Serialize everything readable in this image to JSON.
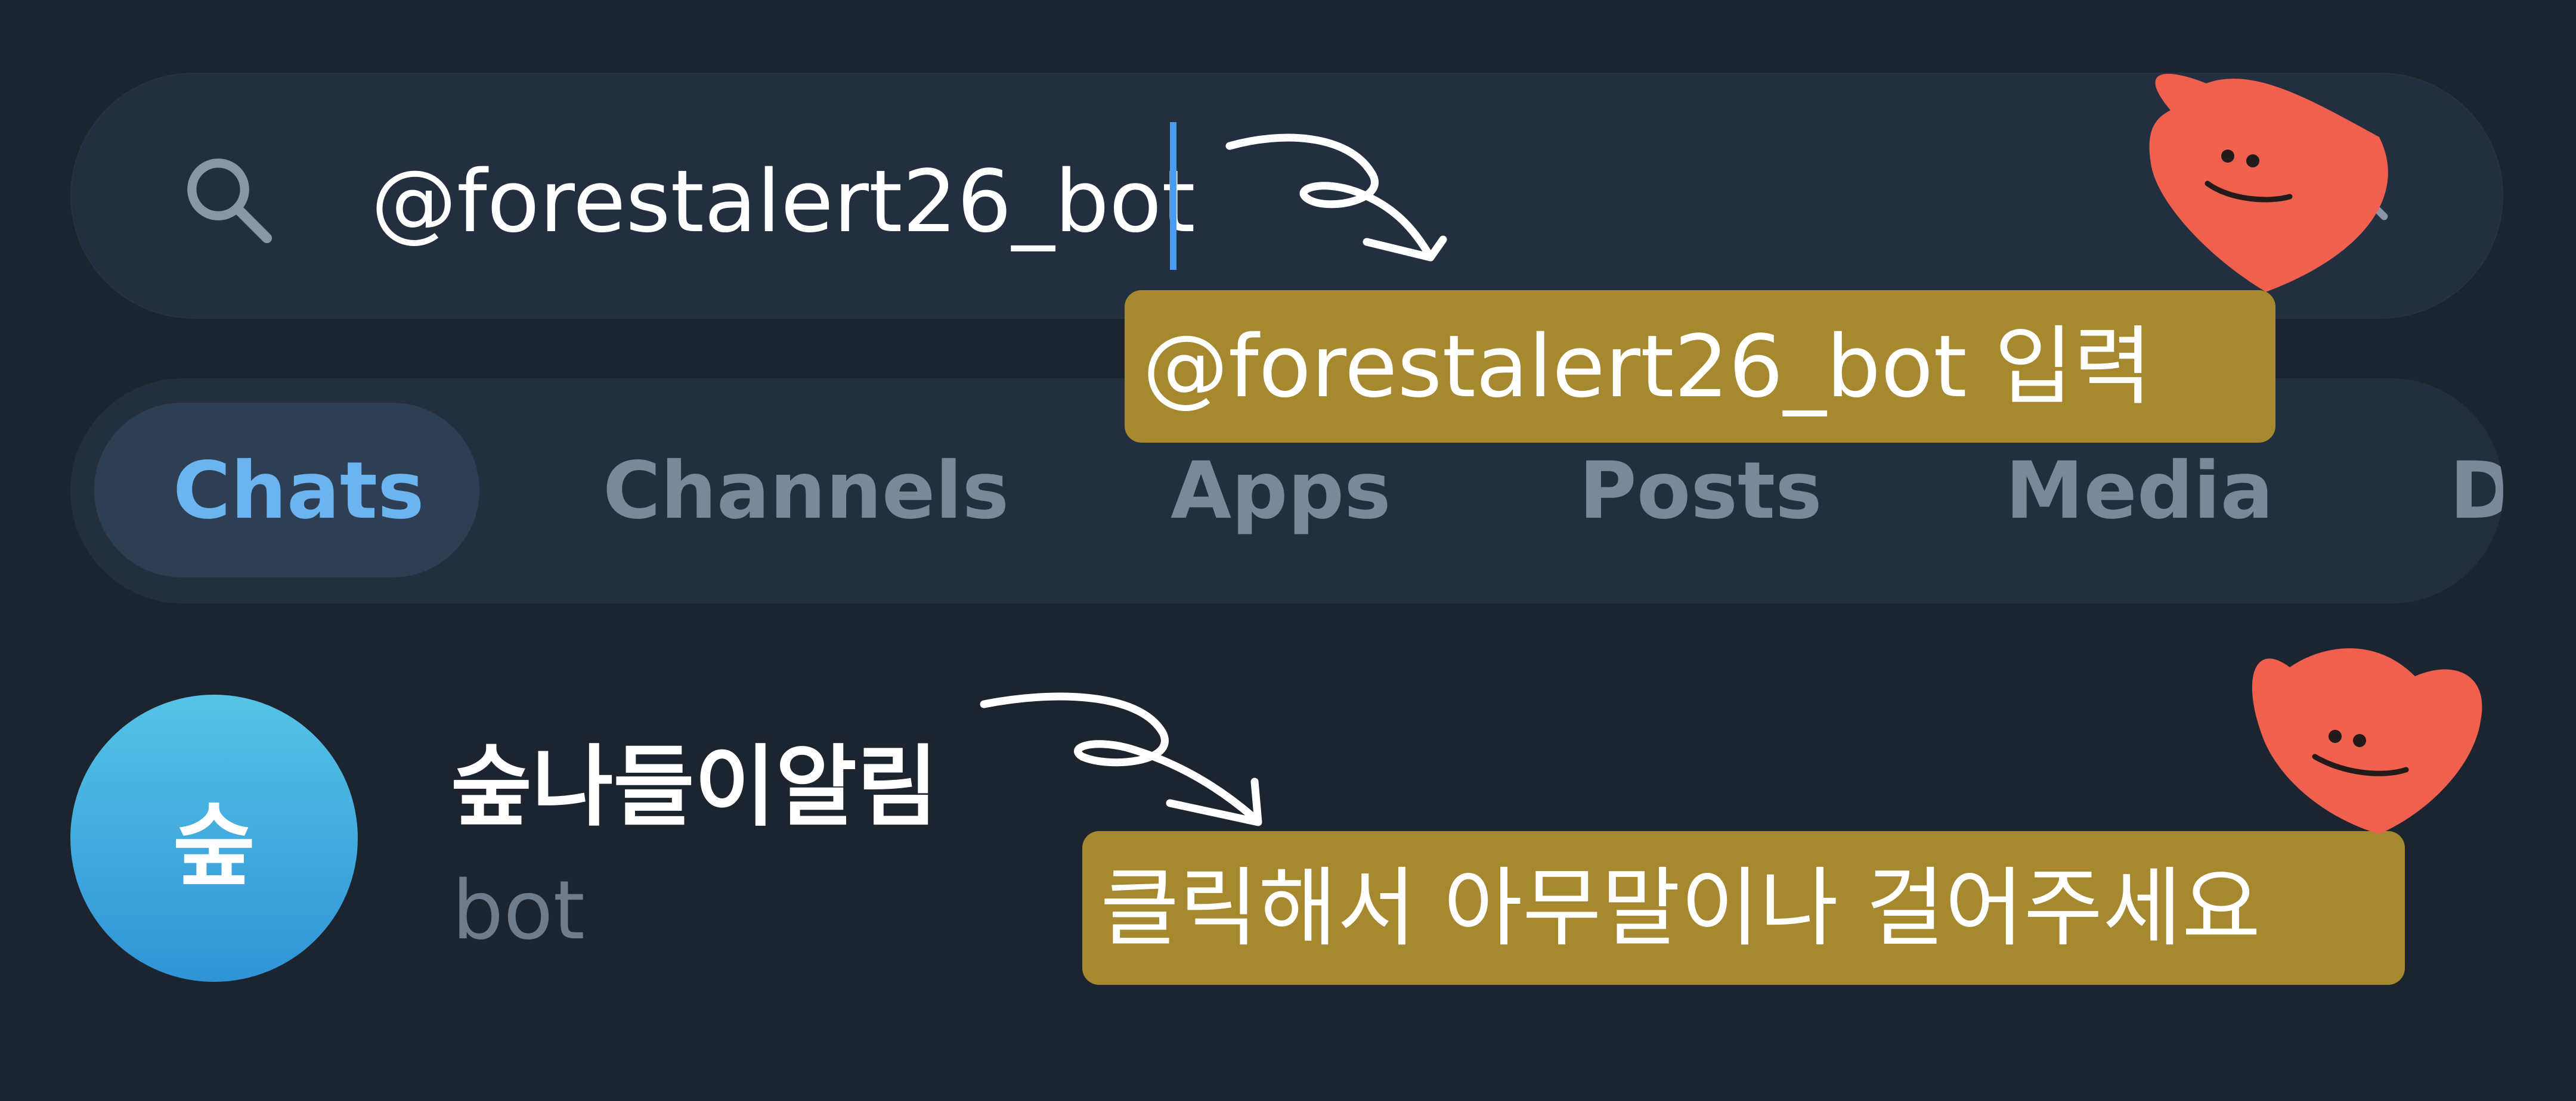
{
  "search": {
    "value": "@forestalert26_bot",
    "search_icon": "search-icon",
    "clear_icon": "close-icon"
  },
  "tabs": [
    {
      "label": "Chats",
      "active": true
    },
    {
      "label": "Channels",
      "active": false
    },
    {
      "label": "Apps",
      "active": false
    },
    {
      "label": "Posts",
      "active": false
    },
    {
      "label": "Media",
      "active": false
    },
    {
      "label": "D",
      "active": false
    }
  ],
  "result": {
    "avatar_text": "숲",
    "title": "숲나들이알림",
    "subtitle": "bot"
  },
  "annotations": {
    "note_search": "@forestalert26_bot 입력",
    "note_result": "클릭해서 아무말이나 걸어주세요",
    "sticker_icon": "smiling-heart-icon"
  },
  "colors": {
    "background": "#1c2430",
    "surface": "#232f3f",
    "accent": "#6cb4f0",
    "caret": "#4a9cf0",
    "note_bg": "#a6882f",
    "heart": "#f0604e"
  }
}
